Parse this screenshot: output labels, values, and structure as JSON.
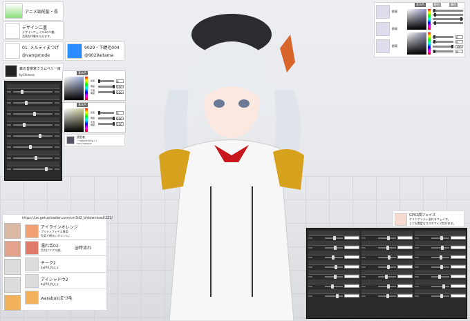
{
  "top_left": {
    "items": [
      {
        "label": "アニメ調前髪・長"
      },
      {
        "label": "デザイン二重",
        "desc": "デザインフェイス3の二重。\n活発な印象を与えます。"
      },
      {
        "label": "01. メルティまつげ",
        "author": "@vampmode"
      },
      {
        "label": "9029・下睫毛004",
        "author": "@9029aitama"
      },
      {
        "label": "森の音楽家クラムベリー目",
        "author": "byChimera"
      }
    ]
  },
  "left_sliders": {
    "min": "MIN",
    "max": "MAX"
  },
  "color_picker_left": {
    "tabs": [
      "基本色",
      "基本色"
    ],
    "channels": [
      "彩度",
      "明度",
      "不透明度"
    ],
    "values": [
      "0",
      "100",
      "100"
    ]
  },
  "attribution_left": {
    "title": "設定者",
    "text": "ーベ社のまぎれなくて",
    "sub": "KoinoYukagaki"
  },
  "top_right": {
    "labels": [
      "叡弱",
      "叡弱",
      "叡弱"
    ],
    "tabs": [
      "基本色",
      "影色",
      "髪色"
    ],
    "values": [
      "0",
      "0",
      "100",
      "0"
    ]
  },
  "bottom_left": {
    "url": "https://ux.getuploader.com/cm3d2_b/download/221/",
    "items": [
      {
        "label": "アイラインオレンジ",
        "desc": "プリティフェイス専用\n元気で明るいオレンジ。"
      },
      {
        "label": "濡れ舌02",
        "desc": "舌だけリアル調。"
      },
      {
        "label": "チーク2",
        "author": "by(P.K_N_z_z"
      },
      {
        "label": "アイシャドウ2",
        "author": "by(P.K_N_z_z"
      },
      {
        "label": "warabukiまつ毛"
      }
    ],
    "tag": "@時流れ"
  },
  "bottom_right_card": {
    "title": "GP02顔フェイス",
    "desc": "オリジナリティ溢れるフェイス。\nとても豊富なカスタマイズ性がある。"
  },
  "dark_sliders": {
    "min": "MIN",
    "max": "MAX"
  }
}
